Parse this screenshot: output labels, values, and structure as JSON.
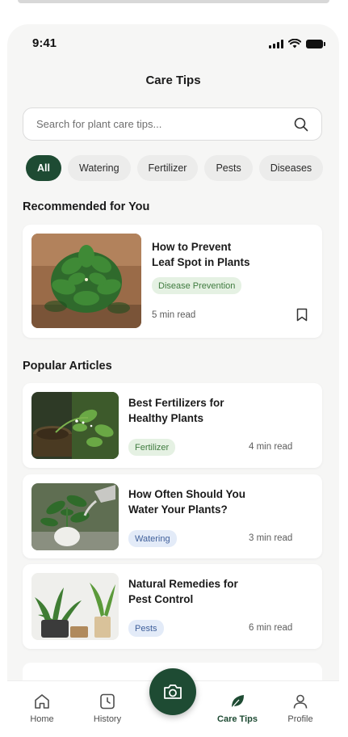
{
  "status_bar": {
    "time": "9:41"
  },
  "header": {
    "title": "Care Tips"
  },
  "search": {
    "placeholder": "Search for plant care tips..."
  },
  "filters": [
    {
      "label": "All",
      "active": true
    },
    {
      "label": "Watering",
      "active": false
    },
    {
      "label": "Fertilizer",
      "active": false
    },
    {
      "label": "Pests",
      "active": false
    },
    {
      "label": "Diseases",
      "active": false
    }
  ],
  "recommended": {
    "section_title": "Recommended for You",
    "article": {
      "title": "How to Prevent\nLeaf Spot in Plants",
      "tag": "Disease Prevention",
      "read_time": "5 min read"
    }
  },
  "popular": {
    "section_title": "Popular Articles",
    "articles": [
      {
        "title": "Best Fertilizers for\nHealthy Plants",
        "tag": "Fertilizer",
        "tag_color": "green",
        "read_time": "4 min read"
      },
      {
        "title": "How Often Should You\nWater Your Plants?",
        "tag": "Watering",
        "tag_color": "blue",
        "read_time": "3 min read"
      },
      {
        "title": "Natural Remedies for\nPest Control",
        "tag": "Pests",
        "tag_color": "blue",
        "read_time": "6 min read"
      }
    ]
  },
  "bottom_nav": {
    "items": [
      {
        "label": "Home",
        "icon": "home-icon"
      },
      {
        "label": "History",
        "icon": "history-icon"
      },
      {
        "label": "Care Tips",
        "icon": "leaf-icon",
        "active": true
      },
      {
        "label": "Profile",
        "icon": "profile-icon"
      }
    ],
    "center_action_icon": "camera-icon"
  },
  "colors": {
    "brand_green": "#1e4b33",
    "background": "#f6f6f5",
    "tag_green_bg": "#e5f1e3",
    "tag_blue_bg": "#e3ebf8"
  }
}
